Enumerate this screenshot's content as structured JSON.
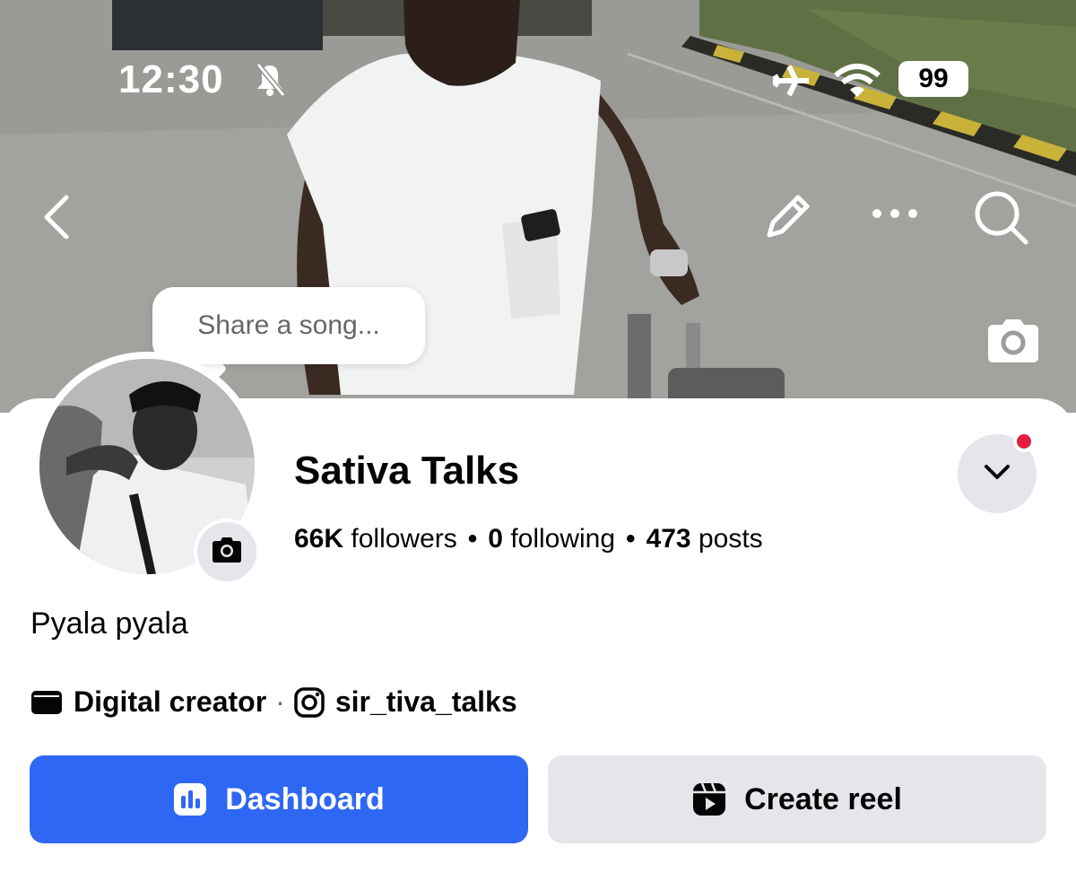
{
  "status_bar": {
    "time": "12:30",
    "battery": "99",
    "icons": [
      "bell-muted-icon",
      "airplane-icon",
      "wifi-icon"
    ]
  },
  "top_nav": {
    "icons": [
      "back-icon",
      "pencil-icon",
      "more-icon",
      "search-icon"
    ]
  },
  "cover": {
    "camera_icon": "camera-icon"
  },
  "song_bubble": {
    "placeholder": "Share a song..."
  },
  "profile": {
    "name": "Sativa Talks",
    "followers_count": "66K",
    "followers_label": "followers",
    "following_count": "0",
    "following_label": "following",
    "posts_count": "473",
    "posts_label": "posts",
    "separator": "•",
    "bio": "Pyala pyala",
    "category": "Digital creator",
    "meta_separator": "·",
    "instagram_handle": "sir_tiva_talks",
    "notification_dot_color": "#e41e3f"
  },
  "actions": {
    "dashboard_label": "Dashboard",
    "create_reel_label": "Create reel",
    "primary_color": "#2f67f5",
    "secondary_color": "#e4e6eb"
  }
}
